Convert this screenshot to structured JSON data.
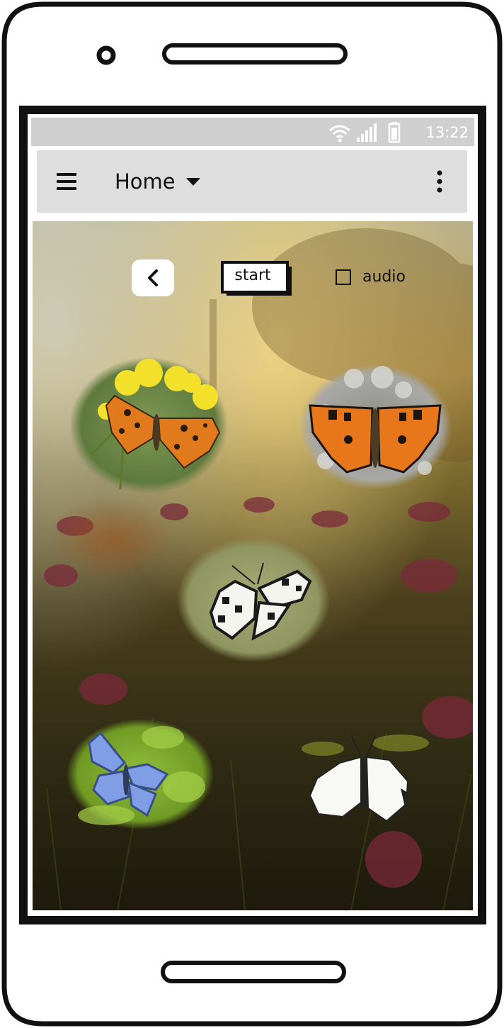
{
  "status_bar": {
    "time": "13:22",
    "icons": [
      "wifi-icon",
      "signal-icon",
      "battery-icon"
    ]
  },
  "app_bar": {
    "title": "Home",
    "icons": [
      "hamburger-menu-icon",
      "dropdown-caret-icon",
      "more-vertical-icon"
    ]
  },
  "controls": {
    "back_icon": "chevron-left-icon",
    "start_label": "start",
    "audio_label": "audio",
    "audio_checked": false
  },
  "butterflies": [
    {
      "name": "comma-butterfly",
      "colors": [
        "#e07a1c",
        "#2a1a0c"
      ]
    },
    {
      "name": "small-tortoiseshell-butterfly",
      "colors": [
        "#e8761a",
        "#1d150d"
      ]
    },
    {
      "name": "marbled-white-butterfly",
      "colors": [
        "#f5f5f0",
        "#1a1a1a"
      ]
    },
    {
      "name": "common-blue-butterfly",
      "colors": [
        "#7f9ee6",
        "#3a4f8a"
      ]
    },
    {
      "name": "cabbage-white-butterfly",
      "colors": [
        "#f8f8f4",
        "#222222"
      ]
    }
  ],
  "colors": {
    "status_bar": "#cfcfcf",
    "app_bar": "#dedede",
    "frame": "#111111"
  }
}
